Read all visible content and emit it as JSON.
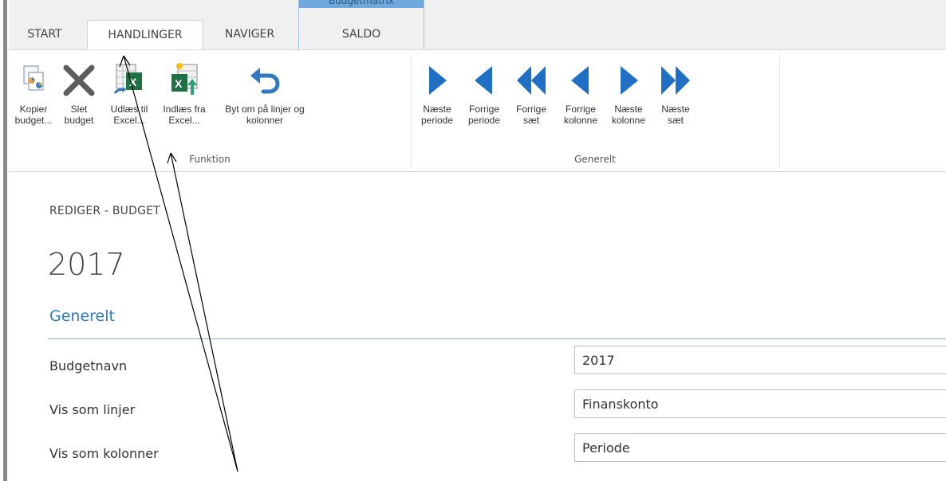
{
  "tabs": {
    "start": "START",
    "handlinger": "HANDLINGER",
    "naviger": "NAVIGER",
    "context_group_label": "Budgetmatrix",
    "saldo": "SALDO"
  },
  "ribbon": {
    "funktion": {
      "group_label": "Funktion",
      "buttons": [
        {
          "label": "Kopier\nbudget...",
          "icon": "copy-budget-icon"
        },
        {
          "label": "Slet\nbudget",
          "icon": "delete-x-icon"
        },
        {
          "label": "Udlæs til\nExcel...",
          "icon": "export-excel-icon"
        },
        {
          "label": "Indlæs fra\nExcel...",
          "icon": "import-excel-icon"
        },
        {
          "label": "Byt om på linjer og\nkolonner",
          "icon": "undo-arrow-icon"
        }
      ]
    },
    "generelt": {
      "group_label": "Generelt",
      "buttons": [
        {
          "label": "Næste\nperiode",
          "icon": "play-right-icon"
        },
        {
          "label": "Forrige\nperiode",
          "icon": "play-left-icon"
        },
        {
          "label": "Forrige\nsæt",
          "icon": "double-left-icon"
        },
        {
          "label": "Forrige\nkolonne",
          "icon": "play-left-icon"
        },
        {
          "label": "Næste\nkolonne",
          "icon": "play-right-icon"
        },
        {
          "label": "Næste\nsæt",
          "icon": "double-right-icon"
        }
      ]
    }
  },
  "page": {
    "breadcrumb": "REDIGER - BUDGET",
    "title": "2017",
    "section": "Generelt",
    "fields": [
      {
        "label": "Budgetnavn",
        "value": "2017"
      },
      {
        "label": "Vis som linjer",
        "value": "Finanskonto"
      },
      {
        "label": "Vis som kolonner",
        "value": "Periode"
      }
    ]
  },
  "colors": {
    "accent_blue": "#2e79c0",
    "nav_arrow_blue": "#1f6fc4",
    "excel_green": "#1e7145"
  }
}
